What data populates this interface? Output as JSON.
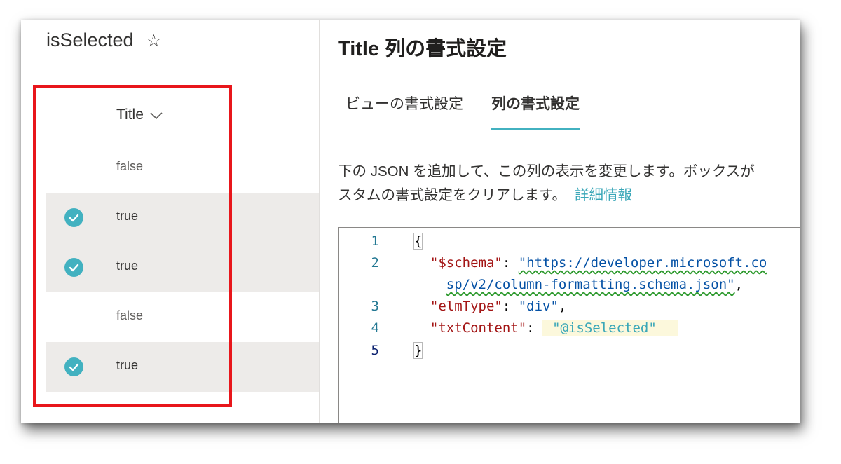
{
  "list": {
    "view_title": "isSelected",
    "column": {
      "label": "Title",
      "icon": "chevron-down-icon"
    },
    "rows": [
      {
        "value": "false",
        "selected": false
      },
      {
        "value": "true",
        "selected": true
      },
      {
        "value": "true",
        "selected": true
      },
      {
        "value": "false",
        "selected": false
      },
      {
        "value": "true",
        "selected": true
      }
    ]
  },
  "panel": {
    "title": "Title 列の書式設定",
    "tabs": [
      {
        "label": "ビューの書式設定",
        "active": false
      },
      {
        "label": "列の書式設定",
        "active": true
      }
    ],
    "description_line1": "下の JSON を追加して、この列の表示を変更します。ボックスが",
    "description_line2": "スタムの書式設定をクリアします。",
    "learn_more": "詳細情報"
  },
  "editor": {
    "line_numbers": [
      "1",
      "2",
      "3",
      "4",
      "5"
    ],
    "schema_key": "\"$schema\"",
    "schema_url_part1": "\"https://developer.microsoft.co",
    "schema_url_part2": "sp/v2/column-formatting.schema.json\"",
    "elm_key": "\"elmType\"",
    "elm_value": "\"div\"",
    "txt_key": "\"txtContent\"",
    "txt_value": "\"@isSelected\""
  },
  "colors": {
    "accent": "#42b1c0",
    "row_selected_bg": "#edebe9",
    "highlight_border": "#e8161b",
    "json_key": "#a31515",
    "json_string": "#0451a5"
  }
}
